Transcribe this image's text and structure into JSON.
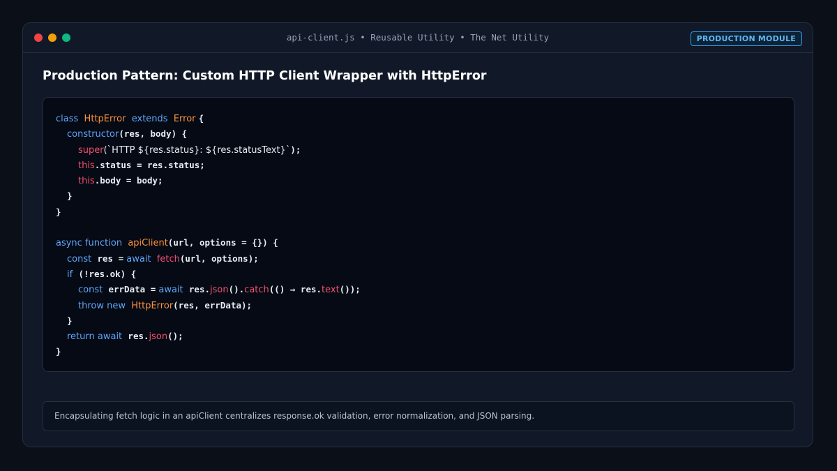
{
  "window": {
    "title": "api-client.js • Reusable Utility • The Net Utility",
    "badge": "PRODUCTION MODULE"
  },
  "heading": "Production Pattern: Custom HTTP Client Wrapper with HttpError",
  "code": {
    "l1": {
      "a": "class",
      "b": "HttpError",
      "c": "extends",
      "d": "Error",
      "e": "{"
    },
    "l2": {
      "a": "constructor",
      "b": "(res, body) {"
    },
    "l3": {
      "a": "super",
      "b": "(`HTTP ${res.status}: ${res.statusText}`",
      ",c": "",
      "c": ");"
    },
    "l4": {
      "a": "this",
      "b": ".status = res.status;"
    },
    "l5": {
      "a": "this",
      "b": ".body = body;"
    },
    "l6": "}",
    "l7": "}",
    "l9": {
      "a": "async function",
      "b": "apiClient",
      "c": "(url, options = {}) {"
    },
    "l10": {
      "a": "const",
      "b": "res =",
      "c": "await",
      "d": "fetch",
      "e": "(url, options);"
    },
    "l11": {
      "a": "if",
      "b": "(!res.ok) {"
    },
    "l12": {
      "a": "const",
      "b": "errData =",
      "c": "await",
      "d": "res.",
      "e": "json",
      "f": "().",
      "g": "catch",
      "h": "(() ⇒ res.",
      "i": "text",
      "j": "());"
    },
    "l13": {
      "a": "throw new",
      "b": "HttpError",
      "c": "(res, errData);"
    },
    "l14": "}",
    "l15": {
      "a": "return await",
      "b": "res.",
      "c": "json",
      "d": "();"
    },
    "l16": "}"
  },
  "footer": "Encapsulating fetch logic in an apiClient centralizes response.ok validation, error normalization, and JSON parsing.",
  "colors": {
    "keyword": "#60a5fa",
    "class": "#fb923c",
    "this": "#f0506e",
    "badge": "#60b4f0"
  }
}
